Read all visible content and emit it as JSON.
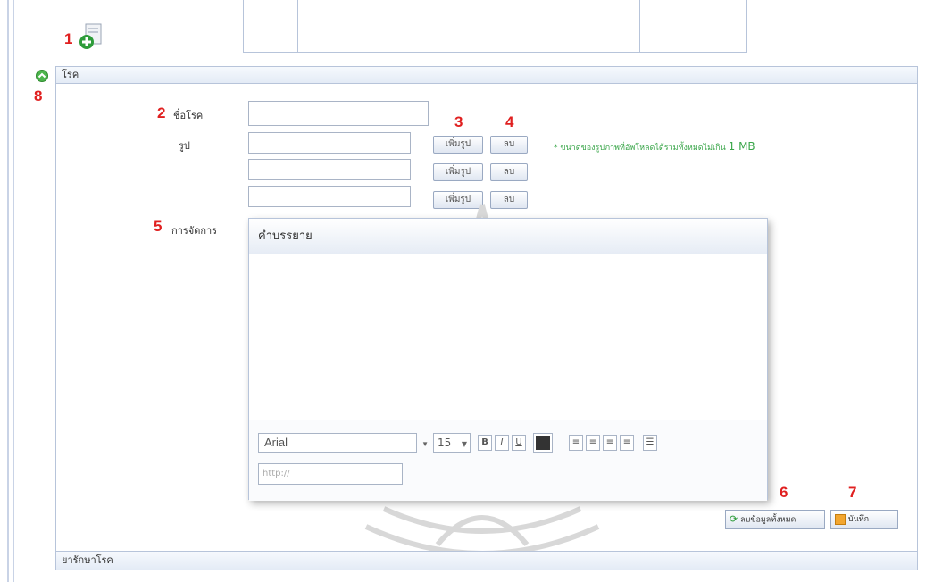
{
  "markers": [
    "1",
    "2",
    "3",
    "4",
    "5",
    "6",
    "7",
    "8"
  ],
  "panels": {
    "disease_header": "โรค",
    "treatment_header": "ยารักษาโรค"
  },
  "form": {
    "name_label": "ชื่อโรค",
    "image_label": "รูป",
    "management_label": "การจัดการ",
    "add_image_label": "เพิ่มรูป",
    "delete_label": "ลบ",
    "note": "* ขนาดของรูปภาพที่อัพโหลดได้รวมทั้งหมดไม่เกิน",
    "note_size": "1 MB"
  },
  "editor": {
    "title": "คำบรรยาย",
    "font": "Arial",
    "font_size": "15",
    "bold": "B",
    "italic": "I",
    "underline": "U",
    "link_placeholder": "http://"
  },
  "actions": {
    "clear_all_label": "ลบข้อมูลทั้งหมด",
    "save_label": "บันทึก"
  },
  "colors": {
    "marker_red": "#e02020",
    "border_blue": "#b7c4da",
    "note_green": "#3aa64a"
  }
}
